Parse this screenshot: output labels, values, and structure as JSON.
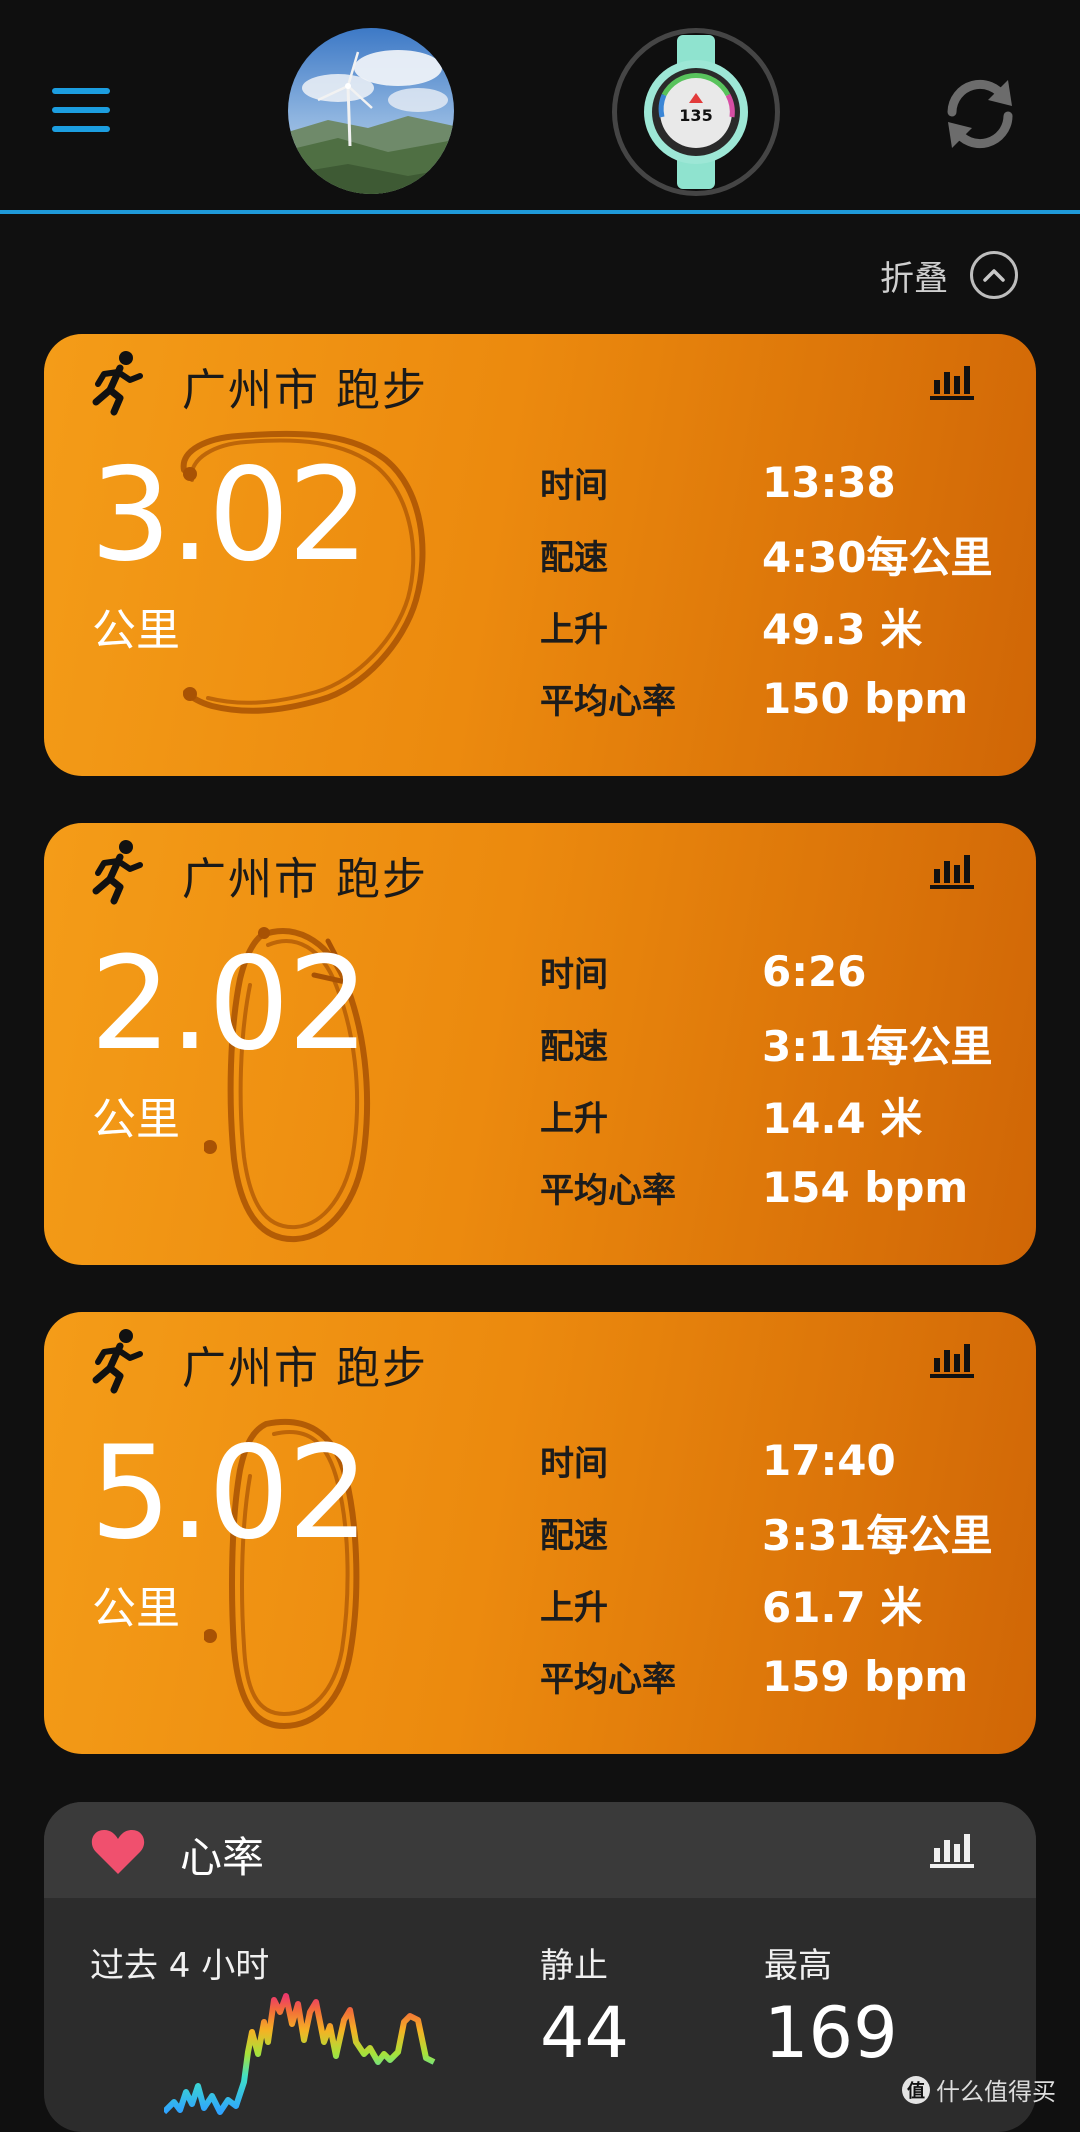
{
  "header": {
    "menu_icon": "hamburger-icon",
    "sync_icon": "sync-icon",
    "accent": "#1f9ad9"
  },
  "toolbar": {
    "collapse_label": "折叠",
    "collapse_icon": "chevron-up-icon"
  },
  "activities": [
    {
      "title": "广州市 跑步",
      "distance": "3.02",
      "unit": "公里",
      "metrics": [
        {
          "label": "时间",
          "value": "13:38"
        },
        {
          "label": "配速",
          "value": "4:30每公里"
        },
        {
          "label": "上升",
          "value": "49.3 米"
        },
        {
          "label": "平均心率",
          "value": "150 bpm"
        }
      ]
    },
    {
      "title": "广州市 跑步",
      "distance": "2.02",
      "unit": "公里",
      "metrics": [
        {
          "label": "时间",
          "value": "6:26"
        },
        {
          "label": "配速",
          "value": "3:11每公里"
        },
        {
          "label": "上升",
          "value": "14.4 米"
        },
        {
          "label": "平均心率",
          "value": "154 bpm"
        }
      ]
    },
    {
      "title": "广州市 跑步",
      "distance": "5.02",
      "unit": "公里",
      "metrics": [
        {
          "label": "时间",
          "value": "17:40"
        },
        {
          "label": "配速",
          "value": "3:31每公里"
        },
        {
          "label": "上升",
          "value": "61.7 米"
        },
        {
          "label": "平均心率",
          "value": "159 bpm"
        }
      ]
    }
  ],
  "heart_rate": {
    "title": "心率",
    "period": "过去 4 小时",
    "rest_label": "静止",
    "rest_value": "44",
    "max_label": "最高",
    "max_value": "169",
    "icon": "heart-icon",
    "heart_color": "#f0506e"
  },
  "watermark": {
    "logo": "值",
    "text": "什么值得买"
  },
  "colors": {
    "card_orange": "#ec8a0e",
    "background": "#101010"
  }
}
